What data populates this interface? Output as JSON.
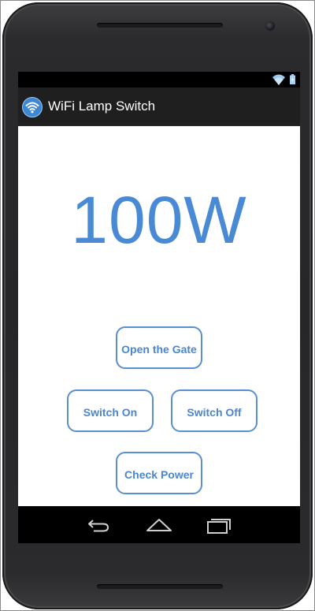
{
  "app": {
    "title": "WiFi Lamp Switch",
    "icon": "wifi-icon"
  },
  "status_bar": {
    "icons": [
      "wifi-signal-icon",
      "battery-icon"
    ]
  },
  "main": {
    "power_reading": "100W"
  },
  "buttons": {
    "open_gate": "Open the Gate",
    "switch_on": "Switch On",
    "switch_off": "Switch Off",
    "check_power": "Check Power"
  },
  "nav_bar": {
    "items": [
      "back-icon",
      "home-icon",
      "recent-apps-icon"
    ]
  },
  "colors": {
    "accent": "#4a8ad4",
    "button_border": "#5a8ed0",
    "action_bar": "#1f1f1f"
  }
}
